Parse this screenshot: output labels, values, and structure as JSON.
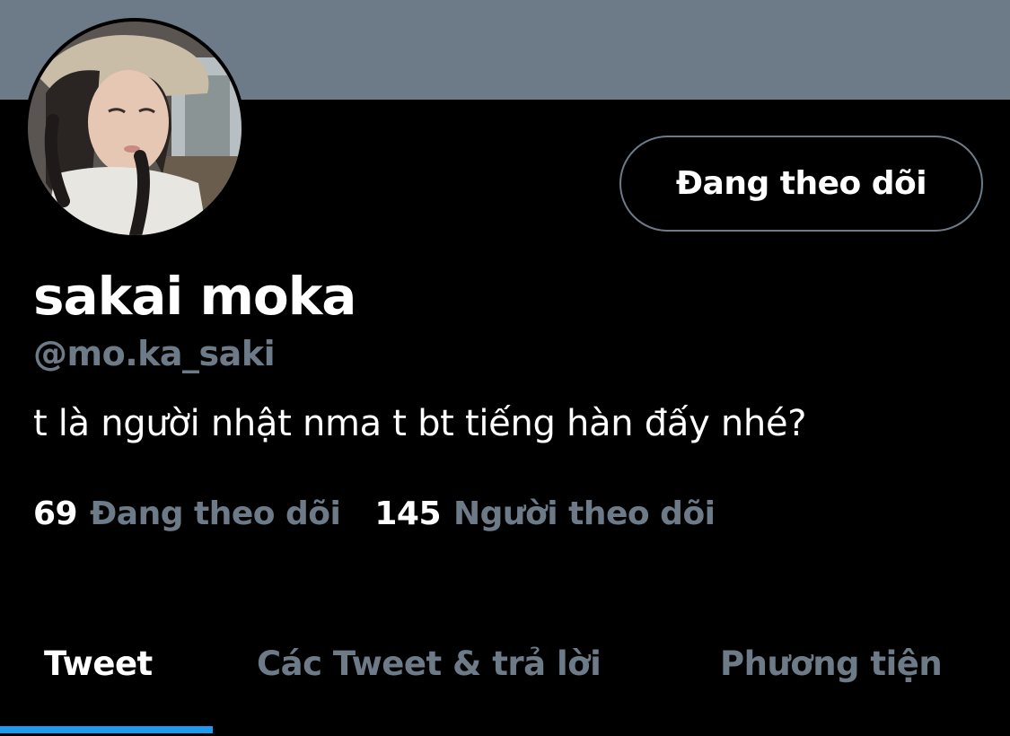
{
  "profile": {
    "display_name": "sakai moka",
    "handle": "@mo.ka_saki",
    "bio": "t là người nhật nma t bt tiếng hàn đấy nhé?",
    "follow_button_label": "Đang theo dõi"
  },
  "stats": {
    "following_count": "69",
    "following_label": "Đang theo dõi",
    "followers_count": "145",
    "followers_label": "Người theo dõi"
  },
  "tabs": [
    {
      "label": "Tweet",
      "active": true
    },
    {
      "label": "Các Tweet & trả lời",
      "active": false
    },
    {
      "label": "Phương tiện",
      "active": false
    }
  ],
  "colors": {
    "background": "#000000",
    "banner": "#6d7b88",
    "muted_text": "#6d7b88",
    "primary_text": "#ffffff",
    "tab_indicator": "#1d9bf0"
  },
  "icons": {
    "avatar": "profile-photo"
  }
}
